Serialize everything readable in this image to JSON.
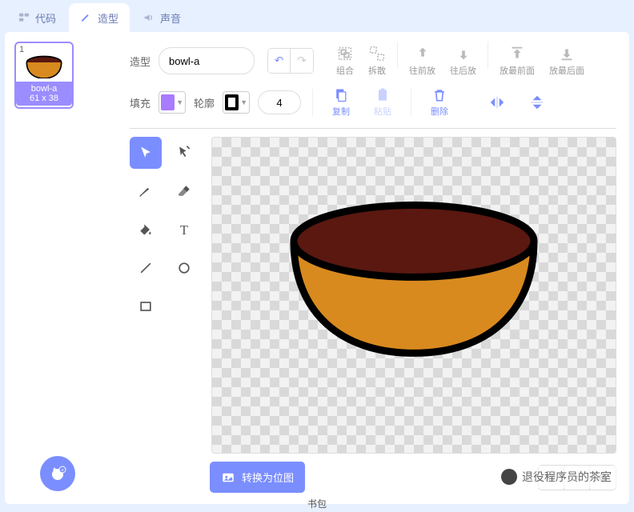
{
  "tabs": {
    "code": "代码",
    "costume": "造型",
    "sound": "声音"
  },
  "costume_item": {
    "num": "1",
    "name": "bowl-a",
    "size": "61 x 38"
  },
  "row1": {
    "label": "造型",
    "name_value": "bowl-a",
    "tools": {
      "group": "组合",
      "ungroup": "拆散",
      "forward": "往前放",
      "backward": "往后放",
      "front": "放最前面",
      "back": "放最后面"
    }
  },
  "row2": {
    "fill_label": "填充",
    "fill_color": "#a87bff",
    "outline_label": "轮廓",
    "stroke_width": "4",
    "edit": {
      "copy": "复制",
      "paste": "粘贴",
      "delete": "删除"
    }
  },
  "convert_label": "转换为位图",
  "footer": "书包",
  "watermark": "退役程序员的茶室"
}
